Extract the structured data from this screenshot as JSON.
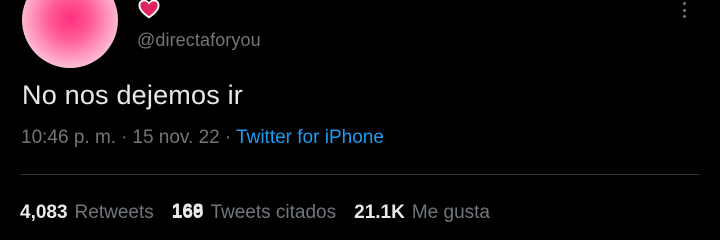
{
  "user": {
    "handle": "@directaforyou",
    "name_emoji": "heart-emoji"
  },
  "tweet": {
    "text": "No nos dejemos ir",
    "time": "10:46 p. m.",
    "date": "15 nov. 22",
    "separator": "·",
    "source": "Twitter for iPhone"
  },
  "stats": {
    "retweets_count": "4,083",
    "retweets_label": "Retweets",
    "quotes_count": "169",
    "quotes_count_overlay": "168",
    "quotes_label": "Tweets citados",
    "likes_count": "21.1K",
    "likes_label": "Me gusta"
  },
  "colors": {
    "background": "#000000",
    "text_primary": "#e7e9ea",
    "text_secondary": "#71767b",
    "link": "#1d9bf0",
    "divider": "#2f3336",
    "heart": "#f91880"
  }
}
